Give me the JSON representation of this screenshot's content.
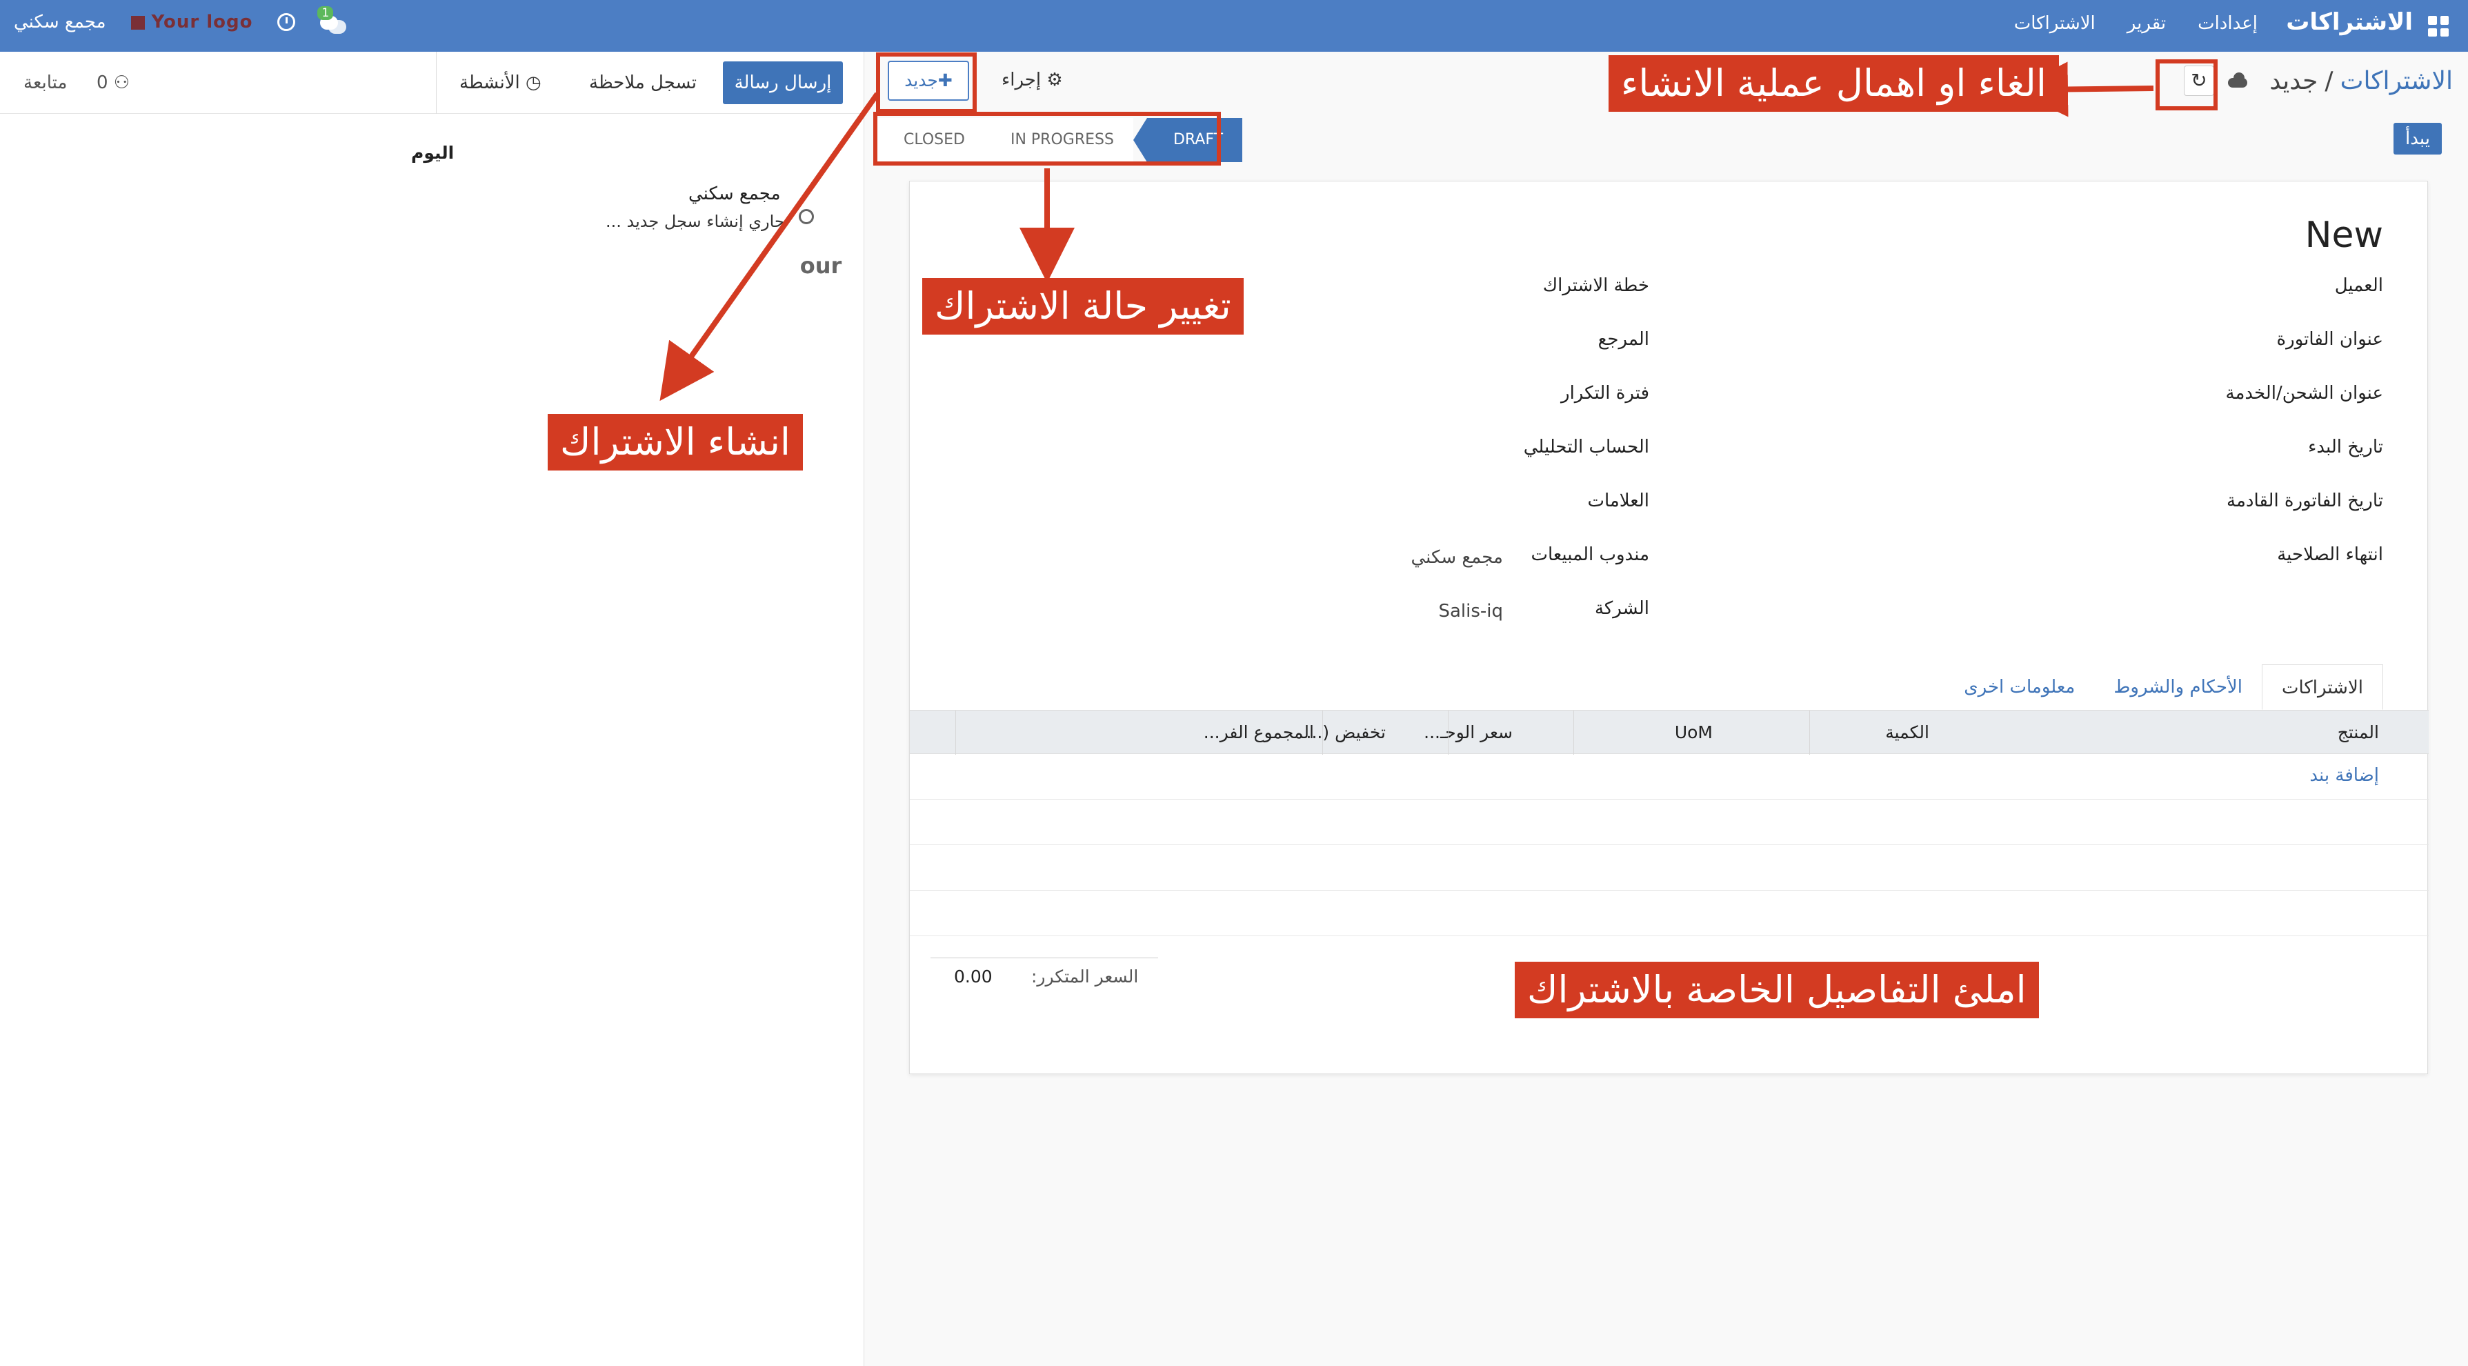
{
  "navbar": {
    "brand": "الاشتراكات",
    "menu": [
      "الاشتراكات",
      "تقرير",
      "إعدادات"
    ],
    "company": "مجمع سكني",
    "logo_text": "Your logo",
    "chat_badge": "1"
  },
  "control_panel": {
    "breadcrumb_root": "الاشتراكات",
    "breadcrumb_separator": "/",
    "breadcrumb_current": "جديد",
    "discard_glyph": "↻",
    "action_label": "⚙ إجراء",
    "new_label": "✚جديد",
    "start_label": "يبدأ"
  },
  "status": {
    "stages": [
      "DRAFT",
      "IN PROGRESS",
      "CLOSED"
    ],
    "active": "DRAFT"
  },
  "form": {
    "title": "New",
    "right_fields": [
      "العميل",
      "عنوان الفاتورة",
      "عنوان الشحن/الخدمة",
      "تاريخ البدء",
      "تاريخ الفاتورة القادمة",
      "انتهاء الصلاحية"
    ],
    "left_fields": [
      "خطة الاشتراك",
      "المرجع",
      "فترة التكرار",
      "الحساب التحليلي",
      "العلامات",
      "مندوب المبيعات",
      "الشركة"
    ],
    "salesperson": "مجمع سكني",
    "company": "Salis-iq",
    "tabs": [
      "الاشتراكات",
      "الأحكام والشروط",
      "معلومات اخرى"
    ],
    "columns": [
      "المنتج",
      "الكمية",
      "UoM",
      "سعر الوحـ...",
      "تخفيض (...",
      "المجموع الفر..."
    ],
    "add_line": "إضافة بند",
    "recurring_price_label": "السعر المتكرر:",
    "recurring_price_value": "0.00"
  },
  "chatter": {
    "send_message": "إرسال رسالة",
    "log_note": "تسجل ملاحظة",
    "activities": "الأنشطة",
    "followers_count": "0",
    "follow": "متابعة",
    "today": "اليوم",
    "author": "مجمع سكني",
    "message": "جاري إنشاء سجل جديد ...",
    "avatar_text": "our"
  },
  "annotations": {
    "discard": "الغاء او اهمال عملية الانشاء",
    "status": "تغيير حالة الاشتراك",
    "create": "انشاء الاشتراك",
    "fill": "املئ التفاصيل الخاصة بالاشتراك"
  },
  "colors": {
    "navbar": "#4c7ec4",
    "primary": "#3f74b8",
    "annotation": "#d33b22"
  }
}
